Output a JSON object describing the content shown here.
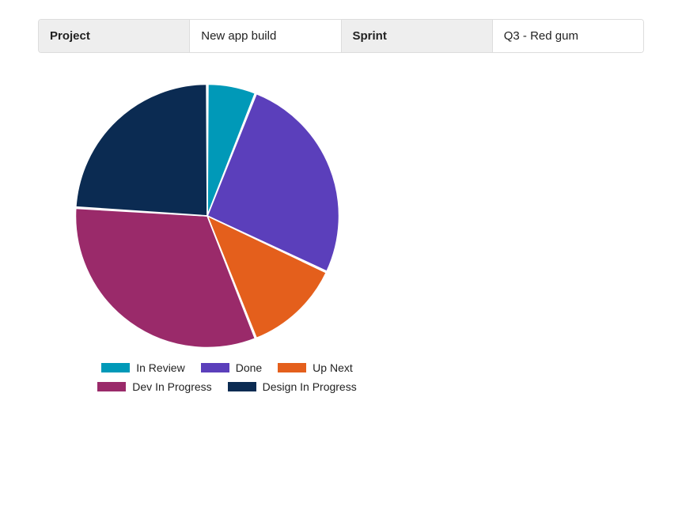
{
  "info": {
    "project_label": "Project",
    "project_value": "New app build",
    "sprint_label": "Sprint",
    "sprint_value": "Q3 - Red gum"
  },
  "chart_data": {
    "type": "pie",
    "title": "",
    "series": [
      {
        "name": "In Review",
        "value": 6,
        "color": "#0099b8"
      },
      {
        "name": "Done",
        "value": 26,
        "color": "#5b3fbb"
      },
      {
        "name": "Up Next",
        "value": 12,
        "color": "#e45f1c"
      },
      {
        "name": "Dev In Progress",
        "value": 32,
        "color": "#9a2a6a"
      },
      {
        "name": "Design In Progress",
        "value": 24,
        "color": "#0b2b52"
      }
    ]
  }
}
